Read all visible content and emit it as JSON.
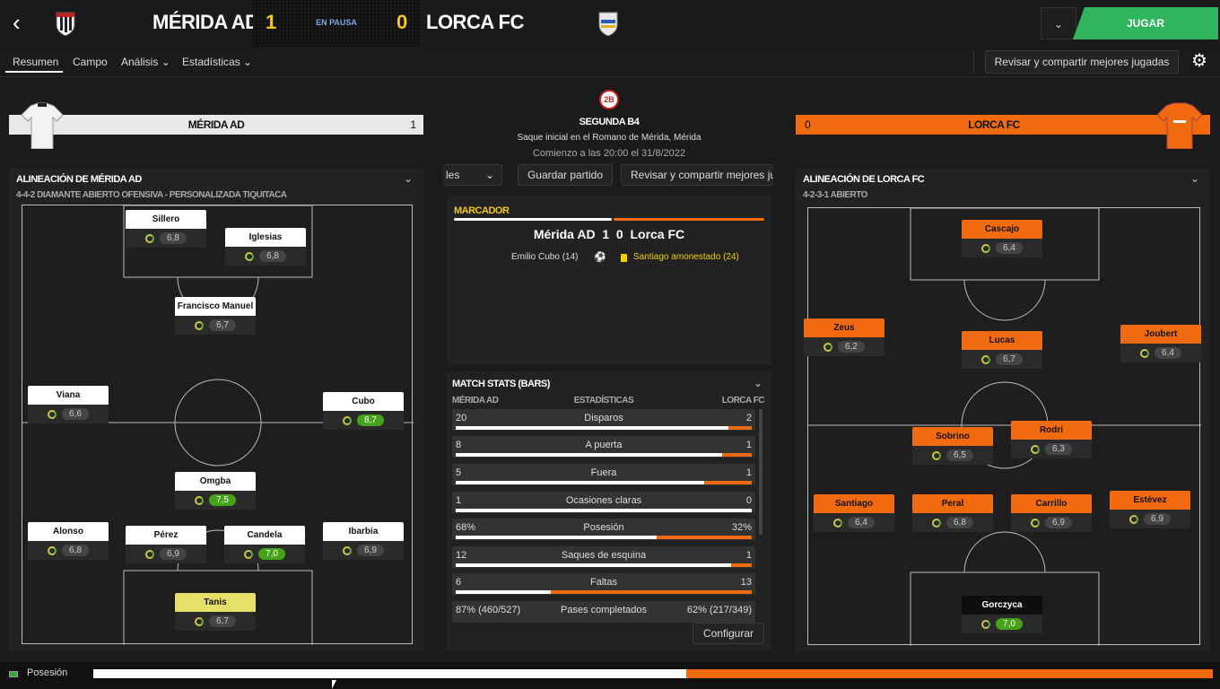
{
  "header": {
    "home_team": "MÉRIDA AD",
    "away_team": "LORCA FC",
    "home_score": "1",
    "away_score": "0",
    "status": "EN PAUSA",
    "play_button": "JUGAR"
  },
  "tabs": [
    "Resumen",
    "Campo",
    "Análisis",
    "Estadísticas"
  ],
  "tabs_selected": "Resumen",
  "review_button": "Revisar y compartir mejores jugadas",
  "home_bar": {
    "team": "MÉRIDA AD",
    "score": "1"
  },
  "away_bar": {
    "team": "LORCA FC",
    "score": "0"
  },
  "match_info": {
    "competition": "SEGUNDA B4",
    "venue": "Saque inicial en el Romano de Mérida, Mérida",
    "time": "Comienzo a las 20:00 el 31/8/2022",
    "competition_badge": "2B"
  },
  "actions": {
    "dropdown": "les",
    "save": "Guardar partido",
    "review": "Revisar y compartir mejores ju"
  },
  "scoreboard": {
    "title": "MARCADOR",
    "line": "Mérida AD  1  0  Lorca FC",
    "home_event": "Emilio Cubo (14)",
    "away_event": "Santiago amonestado (24)"
  },
  "home_lineup": {
    "title": "ALINEACIÓN DE MÉRIDA AD",
    "formation": "4-4-2 DIAMANTE ABIERTO OFENSIVA - PERSONALIZADA TIQUITACA",
    "players": [
      {
        "name": "Sillero",
        "rating": "6,8"
      },
      {
        "name": "Iglesias",
        "rating": "6,8"
      },
      {
        "name": "Francisco Manuel",
        "rating": "6,7"
      },
      {
        "name": "Viana",
        "rating": "6,6"
      },
      {
        "name": "Cubo",
        "rating": "8,7"
      },
      {
        "name": "Omgba",
        "rating": "7,5"
      },
      {
        "name": "Alonso",
        "rating": "6,8"
      },
      {
        "name": "Pérez",
        "rating": "6,9"
      },
      {
        "name": "Candela",
        "rating": "7,0"
      },
      {
        "name": "Ibarbia",
        "rating": "6,9"
      },
      {
        "name": "Tanis",
        "rating": "6,7"
      }
    ]
  },
  "away_lineup": {
    "title": "ALINEACIÓN DE LORCA FC",
    "formation": "4-2-3-1 ABIERTO",
    "players": [
      {
        "name": "Cascajo",
        "rating": "6,4"
      },
      {
        "name": "Zeus",
        "rating": "6,2"
      },
      {
        "name": "Lucas",
        "rating": "6,7"
      },
      {
        "name": "Joubert",
        "rating": "6,4"
      },
      {
        "name": "Sobrino",
        "rating": "6,5"
      },
      {
        "name": "Rodri",
        "rating": "6,3"
      },
      {
        "name": "Santiago",
        "rating": "6,4"
      },
      {
        "name": "Peral",
        "rating": "6,8"
      },
      {
        "name": "Carrillo",
        "rating": "6,9"
      },
      {
        "name": "Estévez",
        "rating": "6,9"
      },
      {
        "name": "Gorczyca",
        "rating": "7,0"
      }
    ]
  },
  "stats": {
    "title": "MATCH STATS (BARS)",
    "home": "MÉRIDA AD",
    "middle": "ESTADÍSTICAS",
    "away": "LORCA FC",
    "rows": [
      {
        "l": "20",
        "c": "Disparos",
        "r": "2",
        "frac": 0.92
      },
      {
        "l": "8",
        "c": "A puerta",
        "r": "1",
        "frac": 0.9
      },
      {
        "l": "5",
        "c": "Fuera",
        "r": "1",
        "frac": 0.84
      },
      {
        "l": "1",
        "c": "Ocasiones claras",
        "r": "0",
        "frac": 1.0
      },
      {
        "l": "68%",
        "c": "Posesión",
        "r": "32%",
        "frac": 0.68
      },
      {
        "l": "12",
        "c": "Saques de esquina",
        "r": "1",
        "frac": 0.93
      },
      {
        "l": "6",
        "c": "Faltas",
        "r": "13",
        "frac": 0.32
      }
    ],
    "last_row": {
      "l": "87% (460/527)",
      "c": "Pases completados",
      "r": "62% (217/349)"
    },
    "configure": "Configurar"
  },
  "bottom": {
    "label": "Posesión",
    "home_fraction": 0.53
  },
  "colors": {
    "away": "#f26a0f",
    "play": "#2fb55c"
  }
}
